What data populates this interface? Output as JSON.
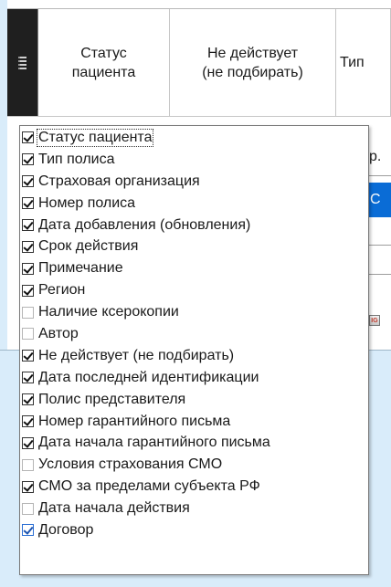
{
  "grid": {
    "columns": [
      {
        "label": "Статус\nпациента"
      },
      {
        "label": "Не действует\n(не подбирать)"
      },
      {
        "label": "Тип"
      }
    ],
    "peek_text": "р.",
    "peek_selected_text": "С"
  },
  "column_chooser": {
    "items": [
      {
        "label": "Статус пациента",
        "checked": true
      },
      {
        "label": "Тип полиса",
        "checked": true
      },
      {
        "label": "Страховая организация",
        "checked": true
      },
      {
        "label": "Номер полиса",
        "checked": true
      },
      {
        "label": "Дата добавления (обновления)",
        "checked": true
      },
      {
        "label": "Срок действия",
        "checked": true
      },
      {
        "label": "Примечание",
        "checked": true
      },
      {
        "label": "Регион",
        "checked": true
      },
      {
        "label": "Наличие ксерокопии",
        "checked": false
      },
      {
        "label": "Автор",
        "checked": false
      },
      {
        "label": "Не действует (не подбирать)",
        "checked": true
      },
      {
        "label": "Дата последней идентификации",
        "checked": true
      },
      {
        "label": "Полис представителя",
        "checked": true
      },
      {
        "label": "Номер гарантийного письма",
        "checked": true
      },
      {
        "label": "Дата начала гарантийного письма",
        "checked": true
      },
      {
        "label": "Условия страхования СМО",
        "checked": false
      },
      {
        "label": "СМО за пределами субъекта РФ",
        "checked": true
      },
      {
        "label": "Дата начала действия",
        "checked": false
      },
      {
        "label": "Договор",
        "checked": true
      }
    ]
  },
  "colors": {
    "background": "#d9ecfa",
    "selection": "#0a6cd6"
  }
}
